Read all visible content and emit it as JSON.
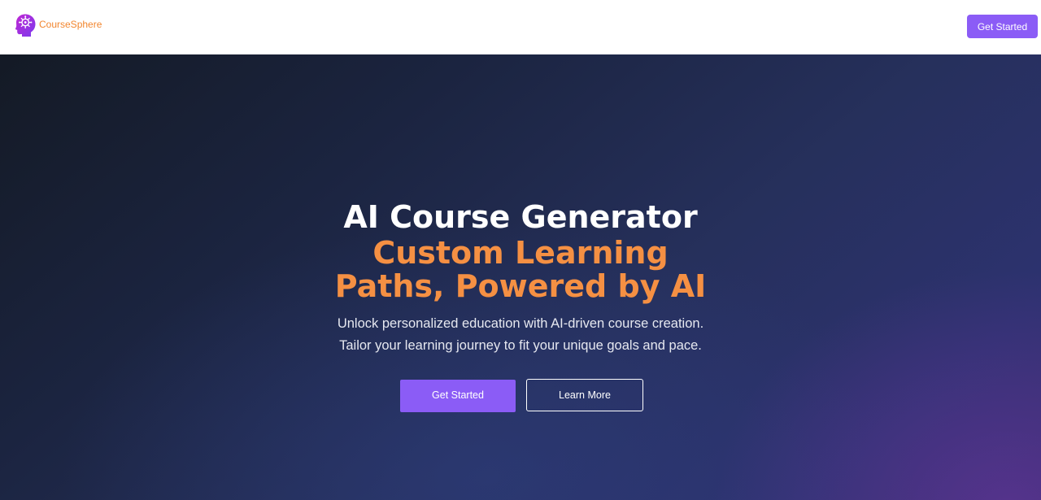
{
  "navbar": {
    "brand_name": "CourseSphere",
    "logo_icon": "brain-head-icon",
    "cta_label": "Get Started"
  },
  "hero": {
    "title": "AI Course Generator",
    "subtitle": "Custom Learning Paths, Powered by AI",
    "description_lines": [
      "Unlock personalized education with AI-driven course creation.",
      "Tailor your learning journey to fit your unique goals and pace."
    ],
    "primary_button": "Get Started",
    "secondary_button": "Learn More"
  },
  "colors": {
    "accent_purple": "#8b5cf6",
    "brand_orange": "#f2862f",
    "subtitle_orange": "#f59043",
    "hero_background_dark": "#141a25",
    "hero_background_purple": "#35306f"
  }
}
